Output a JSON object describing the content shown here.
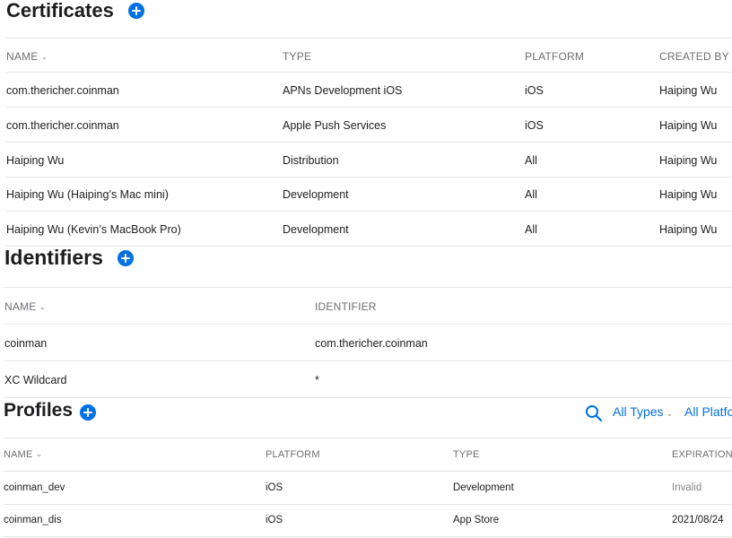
{
  "certificates": {
    "title": "Certificates",
    "columns": {
      "name": "NAME",
      "type": "TYPE",
      "platform": "PLATFORM",
      "created_by": "CREATED BY"
    },
    "rows": [
      {
        "name": "com.thericher.coinman",
        "type": "APNs Development iOS",
        "platform": "iOS",
        "created_by": "Haiping Wu"
      },
      {
        "name": "com.thericher.coinman",
        "type": "Apple Push Services",
        "platform": "iOS",
        "created_by": "Haiping Wu"
      },
      {
        "name": "Haiping Wu",
        "type": "Distribution",
        "platform": "All",
        "created_by": "Haiping Wu"
      },
      {
        "name": "Haiping Wu (Haiping’s Mac mini)",
        "type": "Development",
        "platform": "All",
        "created_by": "Haiping Wu"
      },
      {
        "name": "Haiping Wu (Kevin’s MacBook Pro)",
        "type": "Development",
        "platform": "All",
        "created_by": "Haiping Wu"
      }
    ]
  },
  "identifiers": {
    "title": "Identifiers",
    "columns": {
      "name": "NAME",
      "identifier": "IDENTIFIER"
    },
    "rows": [
      {
        "name": "coinman",
        "identifier": "com.thericher.coinman"
      },
      {
        "name": "XC Wildcard",
        "identifier": "*"
      }
    ]
  },
  "profiles": {
    "title": "Profiles",
    "filters": {
      "types": "All Types",
      "platforms": "All Platfo"
    },
    "columns": {
      "name": "NAME",
      "platform": "PLATFORM",
      "type": "TYPE",
      "expiration": "EXPIRATION"
    },
    "rows": [
      {
        "name": "coinman_dev",
        "platform": "iOS",
        "type": "Development",
        "expiration": "Invalid"
      },
      {
        "name": "coinman_dis",
        "platform": "iOS",
        "type": "App Store",
        "expiration": "2021/08/24"
      }
    ]
  },
  "icons": {
    "add": "plus-circle-icon",
    "search": "search-icon",
    "sort": "chevron-down-icon"
  },
  "colors": {
    "accent": "#0071e3",
    "text": "#1d1d1f",
    "muted": "#86868b",
    "divider": "#e3e3e6"
  }
}
